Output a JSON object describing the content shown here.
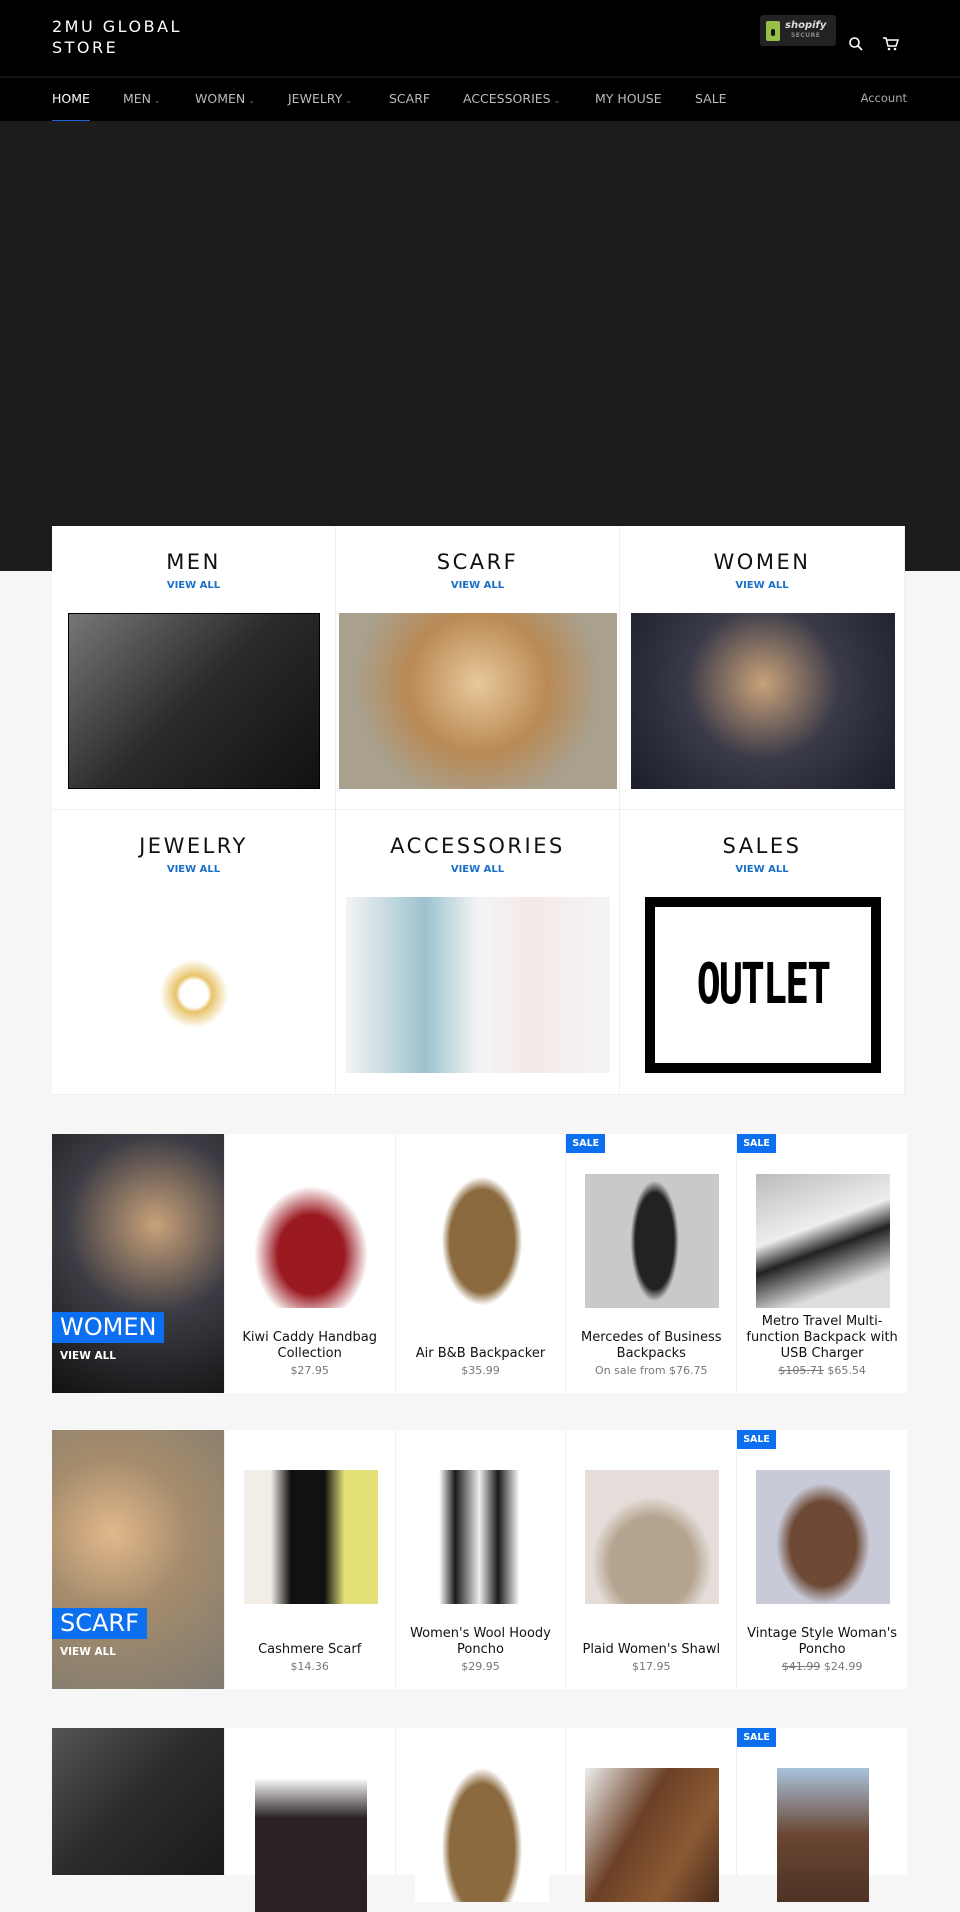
{
  "header": {
    "logo_line1": "2MU GLOBAL",
    "logo_line2": "STORE",
    "badge_brand": "shopify",
    "badge_secure": "SECURE",
    "search_icon": "search-icon",
    "cart_icon": "cart-icon"
  },
  "nav": {
    "items": [
      {
        "label": "HOME",
        "active": true
      },
      {
        "label": "MEN",
        "dropdown": true
      },
      {
        "label": "WOMEN",
        "dropdown": true
      },
      {
        "label": "JEWELRY",
        "dropdown": true
      },
      {
        "label": "SCARF"
      },
      {
        "label": "ACCESSORIES",
        "dropdown": true
      },
      {
        "label": "MY HOUSE"
      },
      {
        "label": "SALE"
      }
    ],
    "account": "Account"
  },
  "collections": [
    {
      "title": "MEN",
      "link": "VIEW ALL"
    },
    {
      "title": "SCARF",
      "link": "VIEW ALL"
    },
    {
      "title": "WOMEN",
      "link": "VIEW ALL"
    },
    {
      "title": "JEWELRY",
      "link": "VIEW ALL"
    },
    {
      "title": "ACCESSORIES",
      "link": "VIEW ALL"
    },
    {
      "title": "SALES",
      "link": "VIEW ALL",
      "image_text": "OUTLET"
    }
  ],
  "sale_badge": "SALE",
  "featured": [
    {
      "label": "WOMEN",
      "link": "VIEW ALL",
      "products": [
        {
          "name": "Kiwi Caddy Handbag Collection",
          "price": "$27.95"
        },
        {
          "name": "Air B&B Backpacker",
          "price": "$35.99"
        },
        {
          "name": "Mercedes of Business Backpacks",
          "price": "On sale from $76.75",
          "sale": true
        },
        {
          "name": "Metro Travel Multi-function Backpack with USB Charger",
          "old_price": "$105.71",
          "price": "$65.54",
          "sale": true
        }
      ]
    },
    {
      "label": "SCARF",
      "link": "VIEW ALL",
      "products": [
        {
          "name": "Cashmere Scarf",
          "price": "$14.36"
        },
        {
          "name": "Women's Wool Hoody Poncho",
          "price": "$29.95"
        },
        {
          "name": "Plaid Women's Shawl",
          "price": "$17.95"
        },
        {
          "name": "Vintage Style Woman's Poncho",
          "old_price": "$41.99",
          "price": "$24.99",
          "sale": true
        }
      ]
    },
    {
      "products": [
        {},
        {},
        {},
        {
          "sale": true
        }
      ]
    }
  ],
  "colors": {
    "accent": "#0c6ff0",
    "link": "#1a6fc9",
    "header": "#000000",
    "hero": "#1c1c1c"
  }
}
